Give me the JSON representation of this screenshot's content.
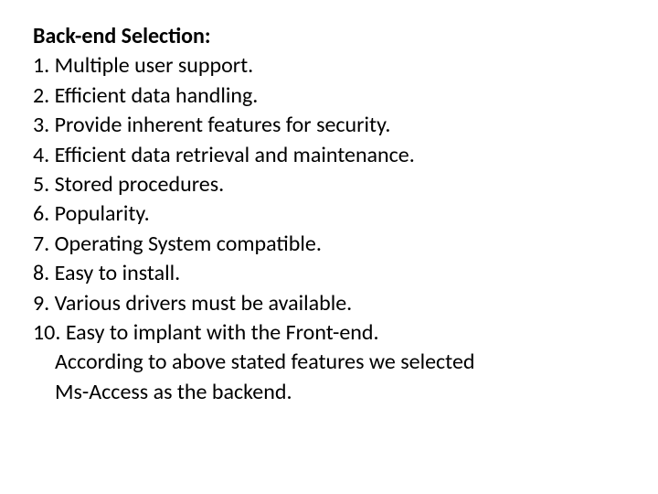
{
  "heading": "Back-end Selection:",
  "items": [
    "1. Multiple user support.",
    "2. Efficient data handling.",
    "3. Provide inherent features for security.",
    "4. Efficient data retrieval and maintenance.",
    "5. Stored procedures.",
    "6. Popularity.",
    "7. Operating System compatible.",
    "8. Easy to install.",
    "9. Various drivers must be available.",
    "10. Easy to implant with the Front-end."
  ],
  "conclusion_line1": "According to above stated features we selected",
  "conclusion_line2": "Ms-Access as the backend."
}
